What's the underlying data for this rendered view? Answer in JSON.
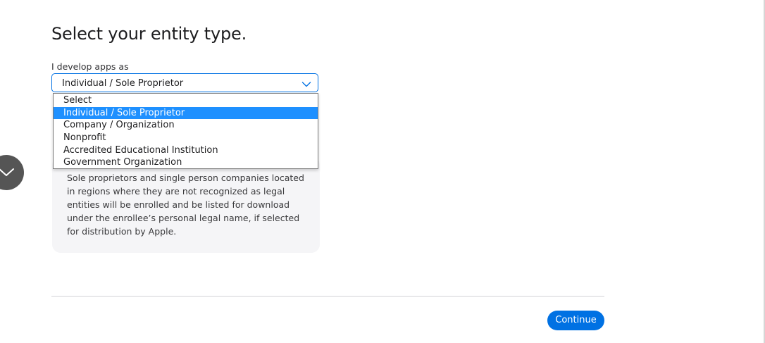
{
  "page": {
    "title": "Select your entity type."
  },
  "entity_field": {
    "label": "I develop apps as",
    "selected_value": "Individual / Sole Proprietor",
    "options": [
      "Select",
      "Individual / Sole Proprietor",
      "Company / Organization",
      "Nonprofit",
      "Accredited Educational Institution",
      "Government Organization"
    ],
    "highlighted_index": 1
  },
  "info_card": {
    "text": "Sole proprietors and single person companies located in regions where they are not recognized as legal entities will be enrolled and be listed for download under the enrollee’s personal legal name, if selected for distribution by Apple."
  },
  "footer": {
    "continue_label": "Continue"
  },
  "icons": {
    "select_chevron": "chevron-down-icon",
    "scroll_button": "chevron-down-icon"
  },
  "colors": {
    "accent": "#0071e3",
    "highlight": "#1e90ff",
    "card_bg": "#f5f5f7",
    "scroll_button_bg": "#555555"
  }
}
